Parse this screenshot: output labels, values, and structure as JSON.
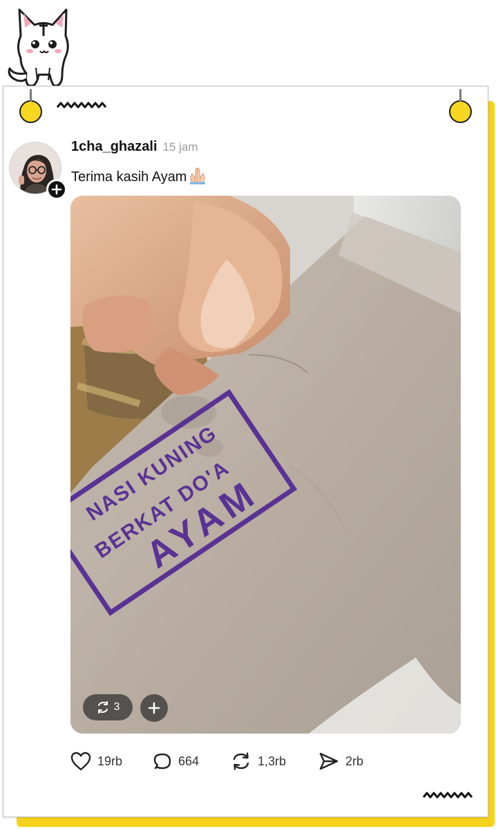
{
  "post": {
    "username": "1cha_ghazali",
    "time": "15 jam",
    "caption": "Terima kasih Ayam",
    "caption_emoji": "folded-hands-emoji",
    "photo": {
      "stamp_lines": [
        "NASI KUNING",
        "BERKAT DO'A",
        "AYAM"
      ],
      "repost_count": "3"
    },
    "actions": {
      "likes": "19rb",
      "replies": "664",
      "reposts": "1,3rb",
      "shares": "2rb"
    }
  },
  "icons": {
    "like": "heart-icon",
    "reply": "comment-icon",
    "repost": "repost-icon",
    "share": "send-icon",
    "follow": "plus-icon"
  },
  "colors": {
    "card_background": "#ffffff",
    "backing_card": "#f5d21c",
    "pin": "#f7d720",
    "stamp_ink": "#5a3294",
    "muted_text": "#9a9a9a"
  }
}
